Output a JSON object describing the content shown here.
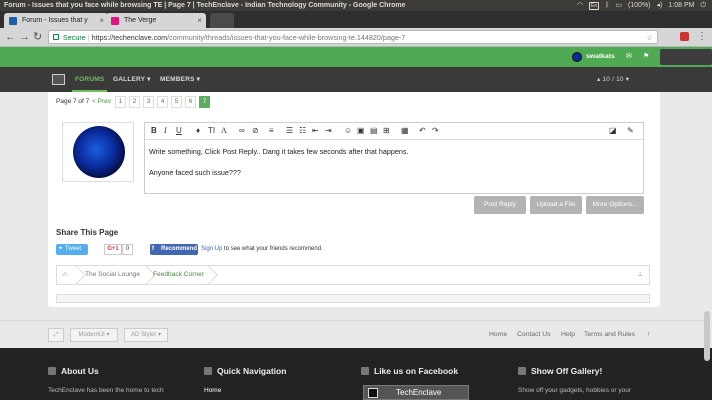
{
  "os": {
    "window_title": "Forum - Issues that you face while browsing TE | Page 7 | TechEnclave - Indian Technology Community - Google Chrome",
    "lang": "En",
    "battery": "(100%)",
    "time": "1:08 PM"
  },
  "browser": {
    "tabs": [
      {
        "label": "Forum - Issues that y",
        "close": "×"
      },
      {
        "label": "The Verge",
        "close": "×"
      }
    ],
    "secure_label": "Secure",
    "url_domain": "https://techenclave.com",
    "url_path": "/community/threads/issues-that-you-face-while-browsing-te.144820/page-7"
  },
  "site": {
    "username": "swatkats",
    "nav": [
      "FORUMS",
      "GALLERY ▾",
      "MEMBERS ▾"
    ],
    "page_counter": "▴ 10 / 10 ▾",
    "colors": {
      "accent": "#50a953",
      "nav_bg": "#3a3a3a",
      "footer_bg": "#222222"
    }
  },
  "pagination": {
    "label": "Page 7 of 7",
    "prev": "< Prev",
    "pages": [
      "1",
      "2",
      "3",
      "4",
      "5",
      "6",
      "7"
    ],
    "current": "7"
  },
  "editor": {
    "line1": "Write something, Click Post Reply.. Dang it takes few seconds after that happens.",
    "line2": "Anyone faced such issue???",
    "buttons": [
      "Post Reply",
      "Upload a File",
      "More Options..."
    ]
  },
  "share": {
    "title": "Share This Page",
    "tweet": "Tweet",
    "gplus": "G+1",
    "gplus_count": "0",
    "fb_recommend": "Recommend",
    "fb_signup": "Sign Up",
    "fb_text": " to see what your friends recommend."
  },
  "breadcrumb": [
    "The Social Lounge",
    "Feedback Corner"
  ],
  "footer_bar": {
    "style1": "ModernUI ▾",
    "style2": "AD Styler ▾",
    "links": [
      "Home",
      "Contact Us",
      "Help",
      "Terms and Rules"
    ]
  },
  "footer": {
    "sections": [
      {
        "title": "About Us",
        "text": "TechEnclave has been the home to tech"
      },
      {
        "title": "Quick Navigation",
        "text": "Home"
      },
      {
        "title": "Like us on Facebook",
        "text": "TechEnclave"
      },
      {
        "title": "Show Off Gallery!",
        "text": "Show off your gadgets, hobbies or your"
      }
    ]
  }
}
